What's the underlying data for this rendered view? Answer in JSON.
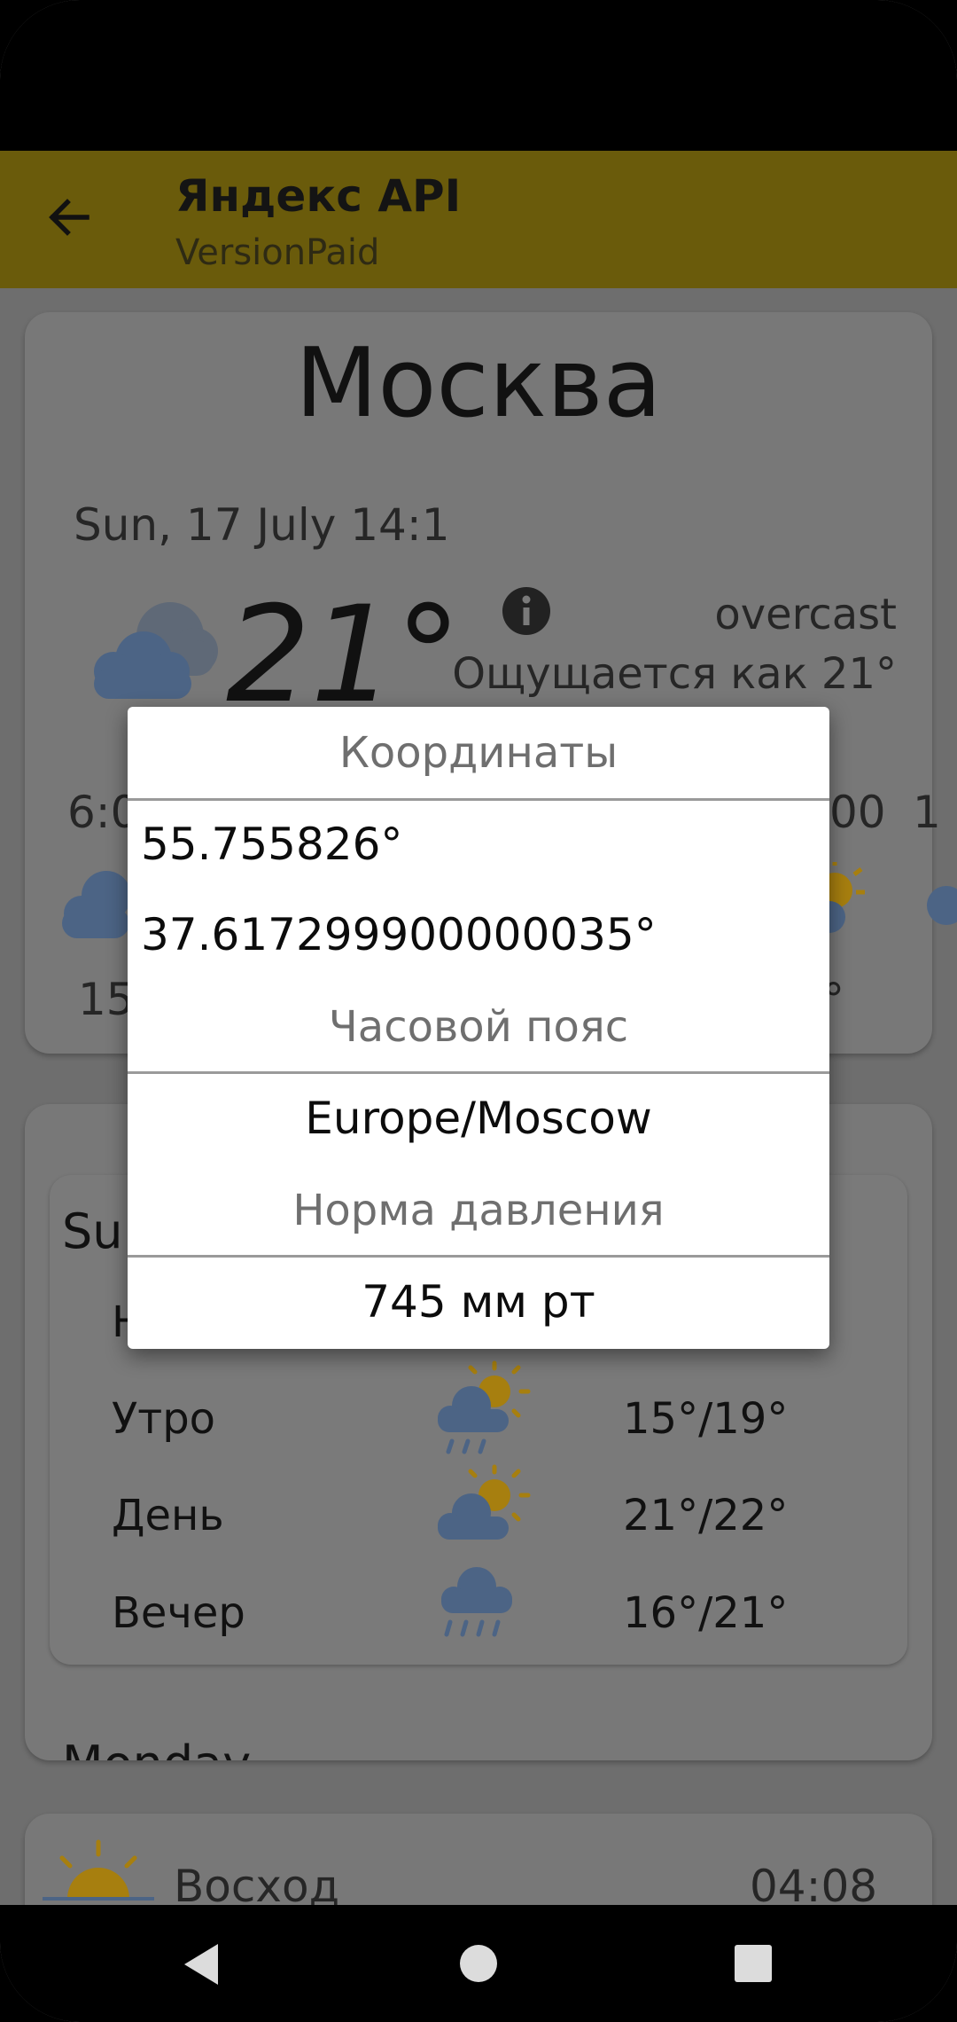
{
  "app_bar": {
    "title": "Яндекс API",
    "subtitle": "VersionPaid"
  },
  "current": {
    "city": "Москва",
    "datetime": "Sun, 17 July 14:1",
    "temperature": "21°",
    "condition": "overcast",
    "feels_like": "Ощущается как 21°",
    "hourly_left_time": "6:0",
    "hourly_left_temp": "15",
    "hourly_right_time": "00",
    "hourly_right_time2": "1",
    "hourly_right_temp": "°"
  },
  "daily": {
    "day_title": "Su",
    "partial_row_initial": "Н",
    "rows": [
      {
        "label": "Утро",
        "temp": "15°/19°",
        "icon": "partly-cloudy-rain-icon"
      },
      {
        "label": "День",
        "temp": "21°/22°",
        "icon": "partly-cloudy-icon"
      },
      {
        "label": "Вечер",
        "temp": "16°/21°",
        "icon": "rain-icon"
      }
    ],
    "next_day_title": "Monday"
  },
  "sun": {
    "sunrise_label": "Восход",
    "sunrise_time": "04:08"
  },
  "dialog": {
    "coordinates_header": "Координаты",
    "latitude": "55.755826°",
    "longitude": "37.617299900000035°",
    "timezone_header": "Часовой пояс",
    "timezone": "Europe/Moscow",
    "pressure_header": "Норма давления",
    "pressure": "745 мм рт"
  },
  "colors": {
    "app_bar": "#6a5b0b",
    "scrim": "#6e6e6e",
    "cloud": "#4c6485",
    "sun": "#a77f0f"
  }
}
